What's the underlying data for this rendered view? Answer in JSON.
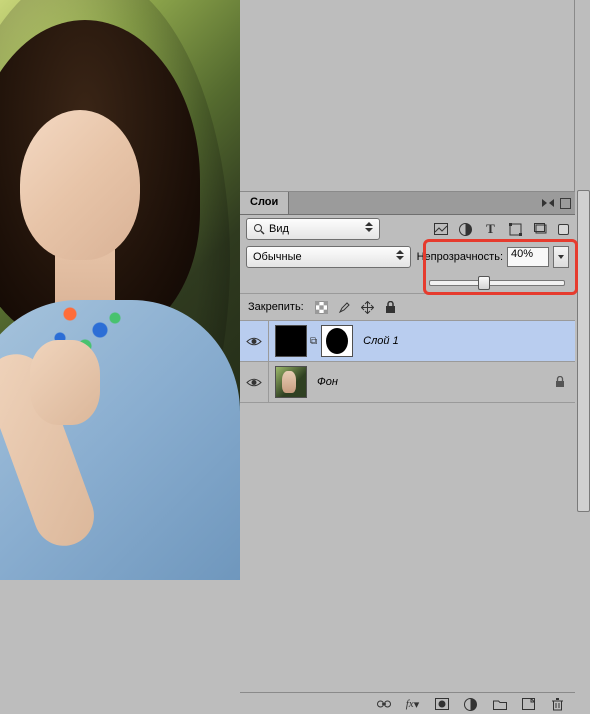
{
  "panel": {
    "title": "Слои",
    "filter_label": "Вид",
    "blend_mode": "Обычные",
    "opacity_label": "Непрозрачность:",
    "opacity_value": "40%",
    "slider_percent": 40,
    "lock_label": "Закрепить:"
  },
  "layers": [
    {
      "name": "Слой 1",
      "visible": true,
      "selected": true,
      "has_mask": true,
      "locked": false
    },
    {
      "name": "Фон",
      "visible": true,
      "selected": false,
      "has_mask": false,
      "locked": true
    }
  ],
  "icons": {
    "filter_image": "image-icon",
    "filter_adjust": "adjust-icon",
    "filter_type": "type-icon",
    "filter_shape": "shape-icon",
    "filter_smart": "smart-icon",
    "lock_transparent": "checker-icon",
    "lock_paint": "brush-icon",
    "lock_move": "move-icon",
    "lock_all": "lock-icon",
    "footer_link": "link-icon",
    "footer_fx": "fx-icon",
    "footer_mask": "mask-icon",
    "footer_adjust": "circle-half-icon",
    "footer_group": "folder-icon",
    "footer_new": "new-layer-icon",
    "footer_trash": "trash-icon"
  }
}
